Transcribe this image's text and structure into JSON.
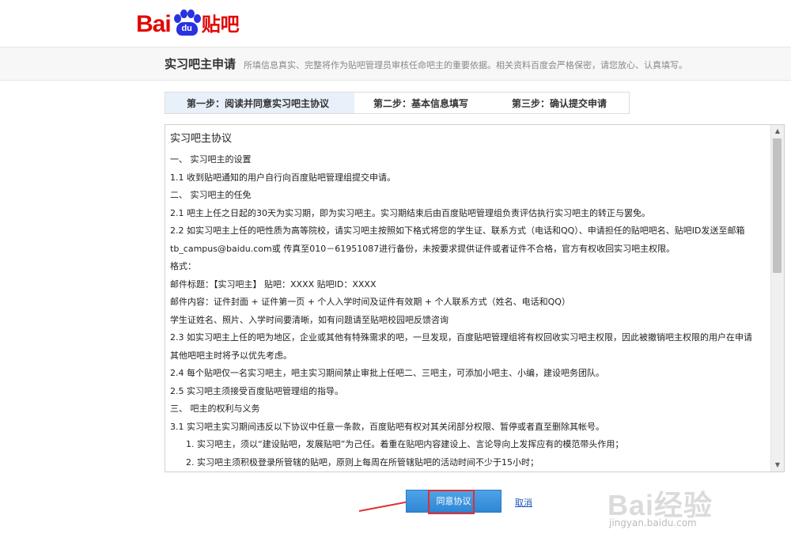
{
  "header": {
    "logo_left": "Bai",
    "logo_paw": "du",
    "logo_right": "贴吧"
  },
  "title_band": {
    "title": "实习吧主申请",
    "description": "所填信息真实、完整将作为贴吧管理员审核任命吧主的重要依据。相关资料百度会严格保密，请您放心、认真填写。"
  },
  "steps": [
    {
      "label": "第一步：阅读并同意实习吧主协议"
    },
    {
      "label": "第二步：基本信息填写"
    },
    {
      "label": "第三步：确认提交申请"
    }
  ],
  "agreement": {
    "heading": "实习吧主协议",
    "lines": [
      "一、 实习吧主的设置",
      "1.1 收到贴吧通知的用户自行向百度贴吧管理组提交申请。",
      "二、 实习吧主的任免",
      "2.1 吧主上任之日起的30天为实习期，即为实习吧主。实习期结束后由百度贴吧管理组负责评估执行实习吧主的转正与罢免。",
      "2.2 如实习吧主上任的吧性质为高等院校，请实习吧主按照如下格式将您的学生证、联系方式（电话和QQ）、申请担任的贴吧吧名、贴吧ID发送至邮箱",
      "tb_campus@baidu.com或 传真至010－61951087进行备份，未按要求提供证件或者证件不合格，官方有权收回实习吧主权限。",
      "格式：",
      "邮件标题：【实习吧主】 贴吧：XXXX 贴吧ID：XXXX",
      "邮件内容：证件封面 + 证件第一页 + 个人入学时间及证件有效期 + 个人联系方式（姓名、电话和QQ）",
      "学生证姓名、照片、入学时间要清晰，如有问题请至贴吧校园吧反馈咨询",
      "2.3 如实习吧主上任的吧为地区，企业或其他有特殊需求的吧，一旦发现，百度贴吧管理组将有权回收实习吧主权限，因此被撤销吧主权限的用户在申请",
      "其他吧吧主时将予以优先考虑。",
      "2.4 每个贴吧仅一名实习吧主，吧主实习期间禁止审批上任吧二、三吧主，可添加小吧主、小编，建设吧务团队。",
      "2.5 实习吧主须接受百度贴吧管理组的指导。",
      "三、 吧主的权利与义务",
      "3.1 实习吧主实习期间违反以下协议中任意一条款，百度贴吧有权对其关闭部分权限、暂停或者直至删除其帐号。"
    ],
    "sub_lines": [
      "1. 实习吧主，须以“建设贴吧，发展贴吧”为己任。着重在贴吧内容建设上、言论导向上发挥应有的模范带头作用；",
      "2. 实习吧主须积极登录所管辖的贴吧，原则上每周在所管辖贴吧的活动时间不少于15小时；"
    ]
  },
  "buttons": {
    "agree": "同意协议",
    "cancel": "取消"
  },
  "watermark": {
    "main": "Bai经验",
    "sub": "jingyan.baidu.com"
  },
  "colors": {
    "brand_red": "#e10602",
    "brand_blue": "#2932e1",
    "button_blue": "#2f86d4",
    "highlight_red": "#e03030",
    "link_blue": "#1b57b8"
  }
}
